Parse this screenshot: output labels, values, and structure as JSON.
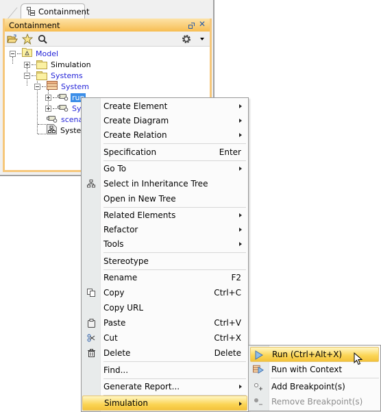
{
  "window": {
    "tab_label": "Containment",
    "panel_title": "Containment",
    "title_controls": [
      "restore-icon",
      "close-icon"
    ],
    "toolbar": [
      "open-folder-icon",
      "star-icon",
      "search-icon",
      "gear-icon"
    ]
  },
  "tree": {
    "nodes": [
      {
        "label": "Model",
        "icon": "model-package-icon",
        "expander": "minus",
        "color": "blue"
      },
      {
        "label": "Simulation",
        "icon": "folder-icon",
        "expander": "plus",
        "color": "black"
      },
      {
        "label": "Systems",
        "icon": "folder-icon",
        "expander": "minus",
        "color": "blue"
      },
      {
        "label": "System",
        "icon": "block-icon",
        "expander": "minus",
        "color": "blue"
      },
      {
        "label": "run",
        "icon": "simulation-config-icon",
        "expander": "plus",
        "color": "blue",
        "selected": true
      },
      {
        "label": "Sys",
        "icon": "simulation-config-icon",
        "expander": "plus",
        "color": "blue"
      },
      {
        "label": "scenar",
        "icon": "simulation-config-icon",
        "expander": "none",
        "color": "blue"
      },
      {
        "label": "System",
        "icon": "diagram-icon",
        "expander": "none",
        "color": "black"
      }
    ]
  },
  "context_menu": {
    "items": [
      {
        "label": "Create Element",
        "submenu": true
      },
      {
        "label": "Create Diagram",
        "submenu": true
      },
      {
        "label": "Create Relation",
        "submenu": true
      },
      {
        "label": "Specification",
        "shortcut": "Enter"
      },
      {
        "label": "Go To",
        "submenu": true
      },
      {
        "label": "Select in Inheritance Tree",
        "icon": "inheritance-tree-icon"
      },
      {
        "label": "Open in New Tree"
      },
      {
        "label": "Related Elements",
        "submenu": true
      },
      {
        "label": "Refactor",
        "submenu": true
      },
      {
        "label": "Tools",
        "submenu": true
      },
      {
        "label": "Stereotype"
      },
      {
        "label": "Rename",
        "shortcut": "F2"
      },
      {
        "label": "Copy",
        "shortcut": "Ctrl+C",
        "icon": "copy-icon"
      },
      {
        "label": "Copy URL"
      },
      {
        "label": "Paste",
        "shortcut": "Ctrl+V",
        "icon": "paste-icon"
      },
      {
        "label": "Cut",
        "shortcut": "Ctrl+X",
        "icon": "cut-icon"
      },
      {
        "label": "Delete",
        "shortcut": "Delete",
        "icon": "delete-icon"
      },
      {
        "label": "Find..."
      },
      {
        "label": "Generate Report...",
        "submenu": true
      },
      {
        "label": "Simulation",
        "submenu": true,
        "highlighted": true
      }
    ]
  },
  "simulation_submenu": {
    "items": [
      {
        "label": "Run (Ctrl+Alt+X)",
        "icon": "run-icon",
        "highlighted": true
      },
      {
        "label": "Run with Context",
        "icon": "run-with-context-icon"
      },
      {
        "label": "Add Breakpoint(s)",
        "icon": "add-breakpoint-icon"
      },
      {
        "label": "Remove Breakpoint(s)",
        "icon": "remove-breakpoint-icon",
        "disabled": true
      }
    ]
  },
  "colors": {
    "accent": "#f7bd52",
    "highlight": "#fbd453",
    "link_blue": "#2323d8",
    "selection": "#3b8ee8"
  }
}
